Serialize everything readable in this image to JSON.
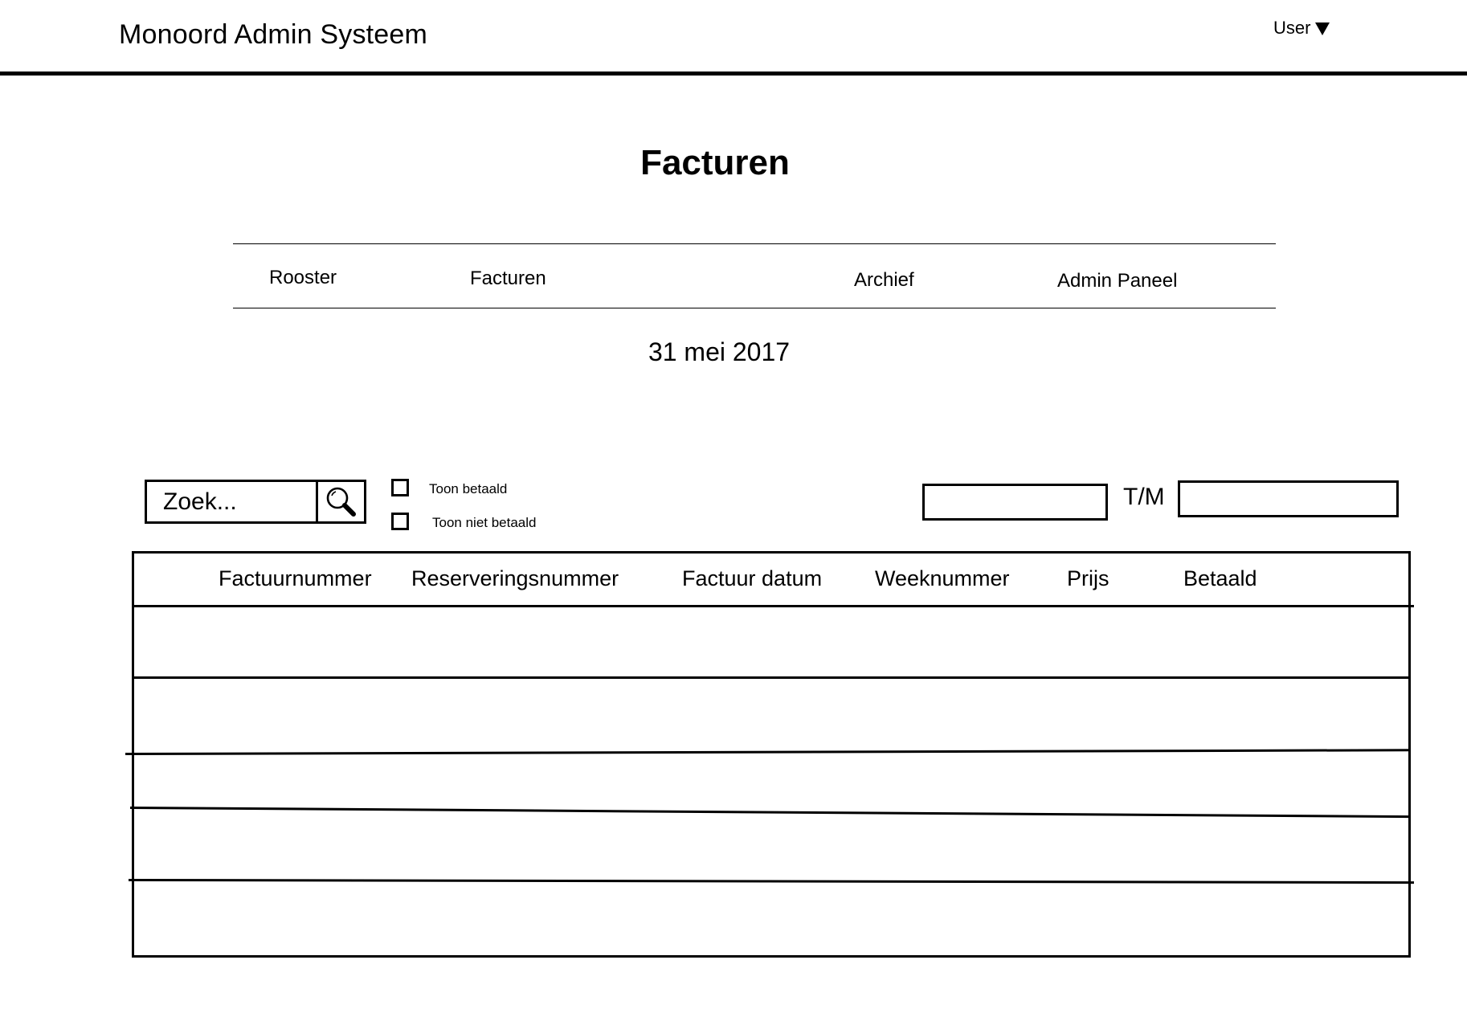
{
  "header": {
    "app_title": "Monoord Admin Systeem",
    "user_label": "User"
  },
  "page": {
    "title": "Facturen",
    "date": "31 mei 2017"
  },
  "nav": {
    "items": [
      {
        "label": "Rooster"
      },
      {
        "label": "Facturen"
      },
      {
        "label": "Archief"
      },
      {
        "label": "Admin Paneel"
      }
    ]
  },
  "filters": {
    "search": {
      "placeholder": "Zoek...",
      "value": "",
      "icon": "search-icon"
    },
    "checkboxes": [
      {
        "label": "Toon betaald",
        "checked": false
      },
      {
        "label": "Toon niet betaald",
        "checked": false
      }
    ],
    "date_range": {
      "from_value": "",
      "to_value": "",
      "separator": "T/M"
    }
  },
  "table": {
    "columns": [
      "Factuurnummer",
      "Reserveringsnummer",
      "Factuur datum",
      "Weeknummer",
      "Prijs",
      "Betaald"
    ],
    "rows": [
      [],
      [],
      [],
      [],
      []
    ]
  }
}
